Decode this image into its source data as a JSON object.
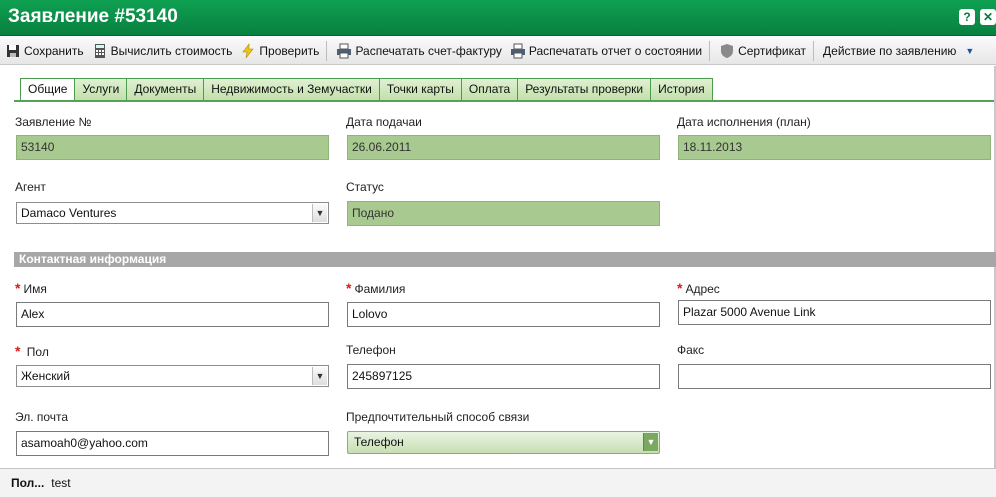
{
  "window": {
    "title": "Заявление #53140",
    "help_label": "?",
    "close_label": "✕"
  },
  "toolbar": {
    "save": "Сохранить",
    "calc_cost": "Вычислить стоимость",
    "check": "Проверить",
    "print_invoice": "Распечатать счет-фактуру",
    "print_status_report": "Распечатать отчет о состоянии",
    "certificate": "Сертификат",
    "application_action": "Действие по заявлению"
  },
  "tabs": [
    {
      "label": "Общие",
      "active": true
    },
    {
      "label": "Услуги"
    },
    {
      "label": "Документы"
    },
    {
      "label": "Недвижимость и Земучастки"
    },
    {
      "label": "Точки карты"
    },
    {
      "label": "Оплата"
    },
    {
      "label": "Результаты проверки"
    },
    {
      "label": "История"
    }
  ],
  "form": {
    "application_no": {
      "label": "Заявление №",
      "value": "53140"
    },
    "submission_date": {
      "label": "Дата подачаи",
      "value": "26.06.2011"
    },
    "planned_completion": {
      "label": "Дата исполнения (план)",
      "value": "18.11.2013"
    },
    "agent": {
      "label": "Агент",
      "value": "Damaco Ventures"
    },
    "status": {
      "label": "Статус",
      "value": "Подано"
    }
  },
  "contact": {
    "header": "Контактная информация",
    "first_name": {
      "label": "Имя",
      "value": "Alex"
    },
    "last_name": {
      "label": "Фамилия",
      "value": "Lolovo"
    },
    "address": {
      "label": "Адрес",
      "value": "Plazar 5000 Avenue Link"
    },
    "gender": {
      "label": "Пол",
      "value": "Женский"
    },
    "phone": {
      "label": "Телефон",
      "value": "245897125"
    },
    "fax": {
      "label": "Факс",
      "value": ""
    },
    "email": {
      "label": "Эл. почта",
      "value": "asamoah0@yahoo.com"
    },
    "preferred_contact": {
      "label": "Предпочтительный способ связи",
      "value": "Телефон"
    },
    "required_mark": "*"
  },
  "statusbar": {
    "user_label": "Пол...",
    "user_value": "test"
  },
  "colors": {
    "title_green": "#0a8a45",
    "readonly_green": "#a8c98f",
    "tab_border": "#4e9a4e"
  }
}
